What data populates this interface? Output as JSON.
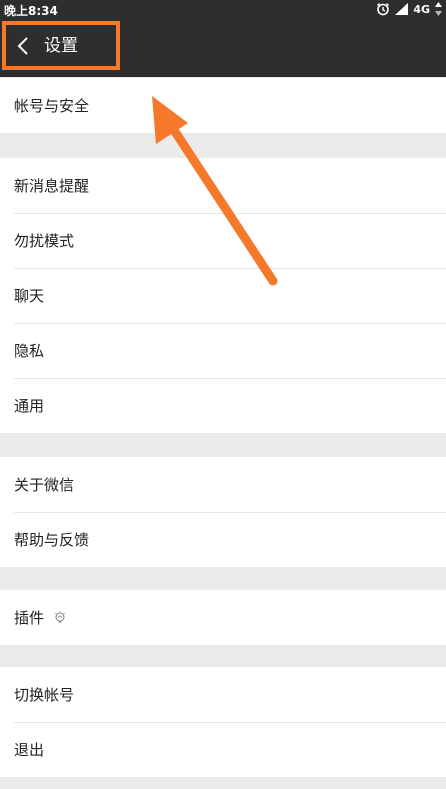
{
  "status_bar": {
    "time": "晚上8:34",
    "network": "4G"
  },
  "header": {
    "title": "设置"
  },
  "groups": [
    {
      "items": [
        {
          "label": "帐号与安全"
        }
      ]
    },
    {
      "items": [
        {
          "label": "新消息提醒"
        },
        {
          "label": "勿扰模式"
        },
        {
          "label": "聊天"
        },
        {
          "label": "隐私"
        },
        {
          "label": "通用"
        }
      ]
    },
    {
      "items": [
        {
          "label": "关于微信"
        },
        {
          "label": "帮助与反馈"
        }
      ]
    },
    {
      "items": [
        {
          "label": "插件"
        }
      ]
    },
    {
      "items": [
        {
          "label": "切换帐号"
        },
        {
          "label": "退出"
        }
      ]
    }
  ],
  "colors": {
    "bar_background": "#2e2e2e",
    "highlight": "#f6782a",
    "page_background": "#ebebeb"
  },
  "icons": {
    "back": "chevron-left-icon",
    "plugin": "bulb-icon",
    "alarm": "alarm-icon",
    "signal": "signal-icon",
    "data": "data-arrows-icon"
  }
}
